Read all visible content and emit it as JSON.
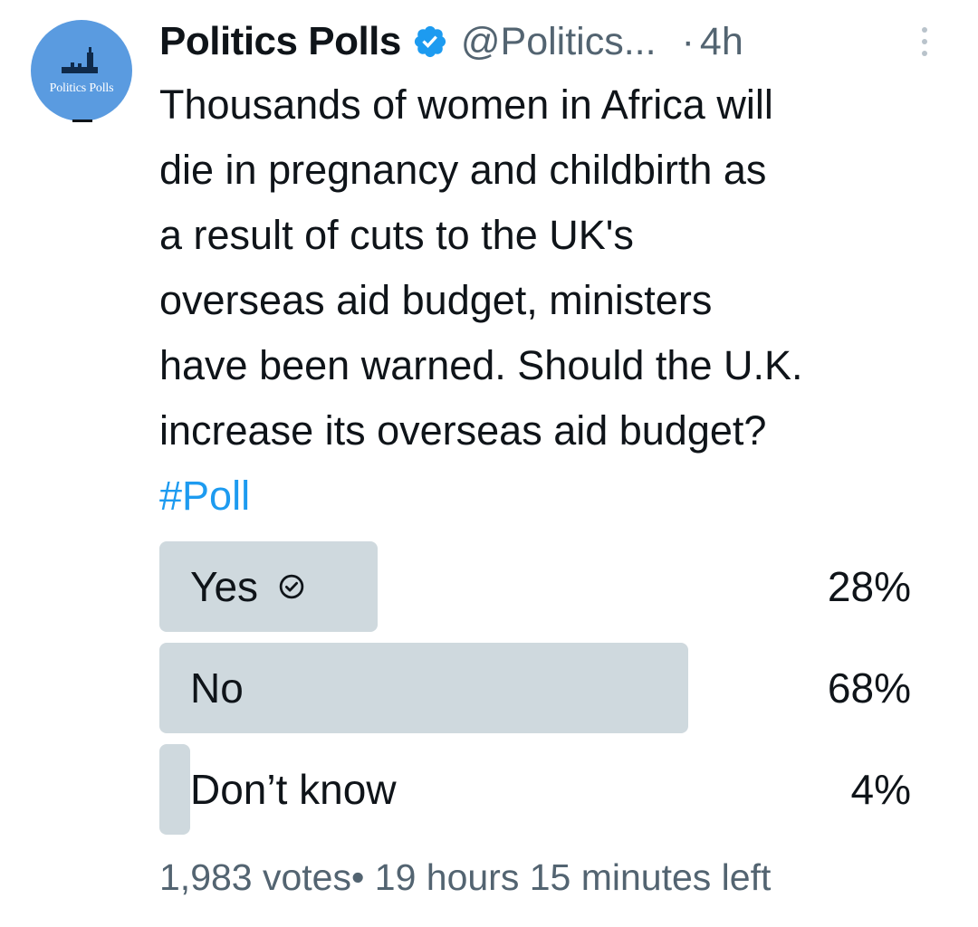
{
  "author": {
    "name": "Politics Polls",
    "handle": "@Politics...",
    "time": "4h",
    "separator": "·",
    "avatar_text": "Politics Polls",
    "verified": true
  },
  "tweet": {
    "lines": [
      "Thousands of women in Africa will",
      "die in pregnancy and childbirth as",
      "a result of cuts to the UK's",
      "overseas aid budget, ministers",
      "have been warned. Should the U.K.",
      "increase its overseas aid budget?"
    ],
    "hashtag": "#Poll"
  },
  "poll": {
    "options": [
      {
        "label": "Yes",
        "percent_text": "28%",
        "fraction": 0.28,
        "selected": true
      },
      {
        "label": "No",
        "percent_text": "68%",
        "fraction": 0.68,
        "selected": false
      },
      {
        "label": "Don’t know",
        "percent_text": "4%",
        "fraction": 0.04,
        "selected": false
      }
    ],
    "votes": "1,983 votes",
    "separator": "•",
    "time_left": "19 hours 15 minutes left"
  },
  "colors": {
    "accent": "#1d9bf0",
    "poll_bar": "#cfd9de",
    "avatar_bg": "#5a9be0",
    "secondary_text": "#536471",
    "primary_text": "#0f1419"
  },
  "icons": {
    "verified": "verified-badge-icon",
    "more": "more-vertical-icon",
    "selected_choice": "check-circle-icon"
  }
}
